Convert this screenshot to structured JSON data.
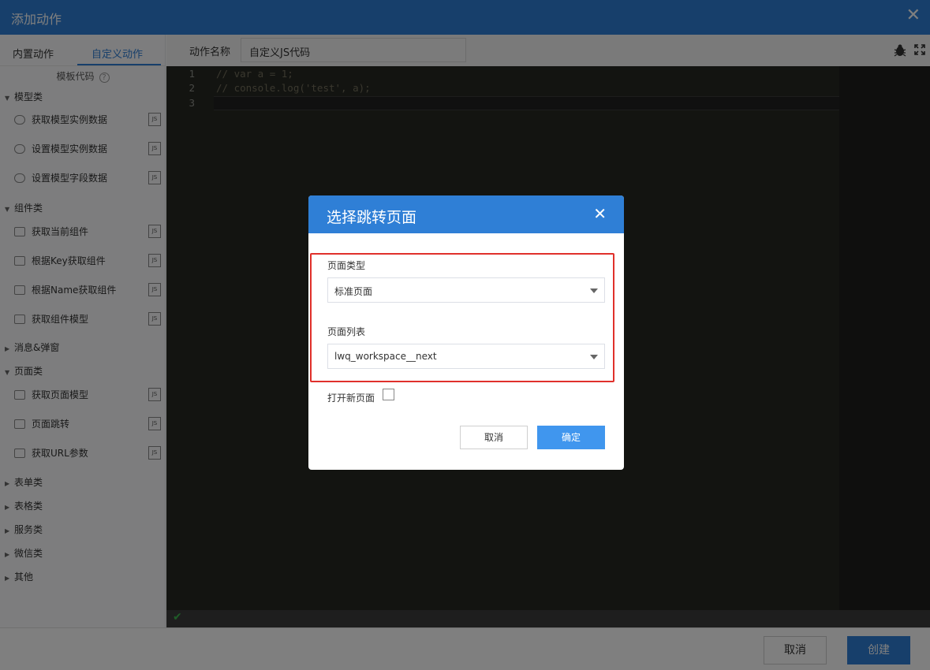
{
  "window": {
    "title": "添加动作",
    "close_glyph": "✕"
  },
  "left": {
    "tabs": [
      {
        "label": "内置动作",
        "active": false
      },
      {
        "label": "自定义动作",
        "active": true
      }
    ],
    "template_header": "模板代码",
    "help_glyph": "?",
    "js_badge": "JS",
    "categories": [
      {
        "label": "模型类",
        "expanded": true,
        "items": [
          "获取模型实例数据",
          "设置模型实例数据",
          "设置模型字段数据"
        ]
      },
      {
        "label": "组件类",
        "expanded": true,
        "items": [
          "获取当前组件",
          "根据Key获取组件",
          "根据Name获取组件",
          "获取组件模型"
        ]
      },
      {
        "label": "消息&弹窗",
        "expanded": false,
        "items": []
      },
      {
        "label": "页面类",
        "expanded": true,
        "items": [
          "获取页面模型",
          "页面跳转",
          "获取URL参数"
        ]
      },
      {
        "label": "表单类",
        "expanded": false,
        "items": []
      },
      {
        "label": "表格类",
        "expanded": false,
        "items": []
      },
      {
        "label": "服务类",
        "expanded": false,
        "items": []
      },
      {
        "label": "微信类",
        "expanded": false,
        "items": []
      },
      {
        "label": "其他",
        "expanded": false,
        "items": []
      }
    ]
  },
  "action_name": {
    "label": "动作名称",
    "value": "自定义JS代码"
  },
  "editor": {
    "lines": [
      {
        "num": "1",
        "text": "// var a = 1;"
      },
      {
        "num": "2",
        "text": "// console.log('test', a);"
      },
      {
        "num": "3",
        "text": ""
      }
    ],
    "status_glyph": "✔"
  },
  "footer": {
    "cancel_label": "取消",
    "create_label": "创建"
  },
  "dialog": {
    "title": "选择跳转页面",
    "close_glyph": "✕",
    "page_type_label": "页面类型",
    "page_type_value": "标准页面",
    "page_list_label": "页面列表",
    "page_list_value": "lwq_workspace__next",
    "open_new_label": "打开新页面",
    "open_new_checked": false,
    "cancel_label": "取消",
    "ok_label": "确定"
  },
  "colors": {
    "accent": "#2f7fd6",
    "highlight_border": "#e0302b",
    "editor_bg": "#272822"
  }
}
